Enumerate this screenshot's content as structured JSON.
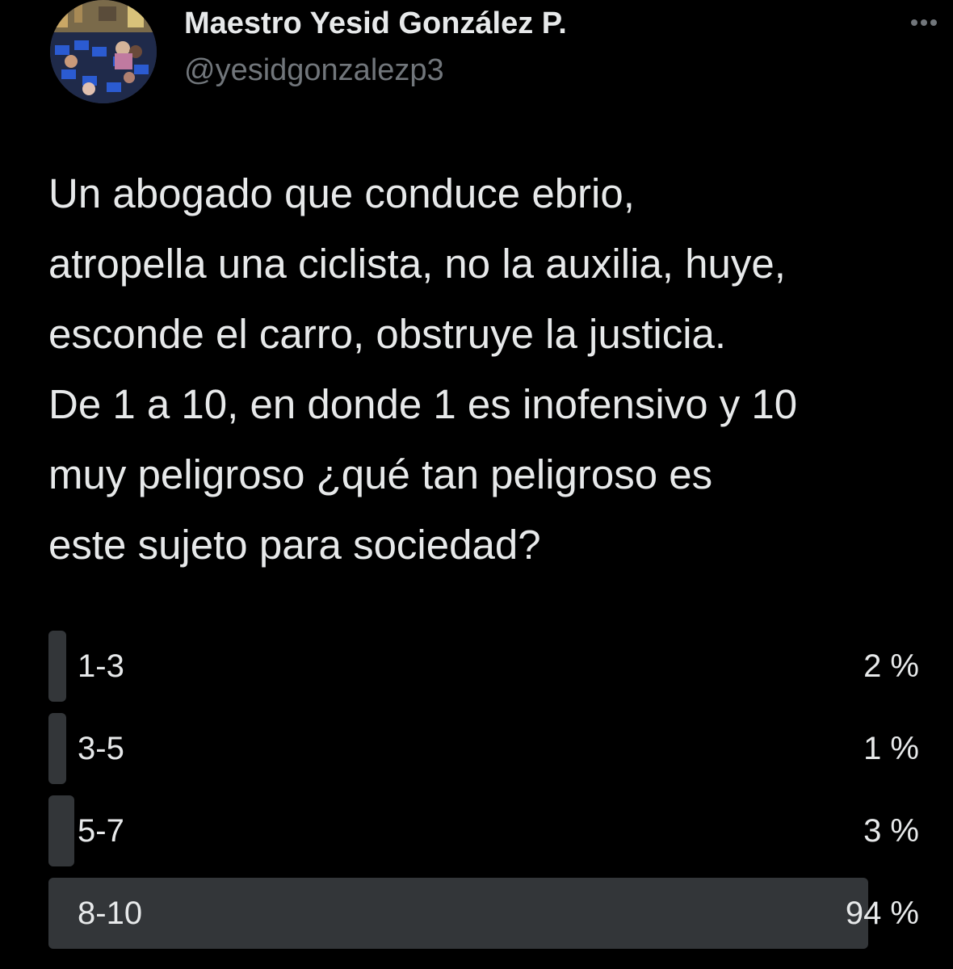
{
  "tweet": {
    "author": {
      "display_name": "Maestro Yesid González P.",
      "handle": "@yesidgonzalezp3"
    },
    "more_icon": "more-horizontal-icon",
    "text": "Un abogado que conduce ebrio,\natropella una ciclista, no la auxilia, huye,\nesconde el carro, obstruye la justicia.\nDe 1 a 10, en donde 1 es inofensivo y 10\nmuy peligroso ¿qué tan peligroso es\neste sujeto para sociedad?"
  },
  "poll": {
    "options": [
      {
        "label": "1-3",
        "percent_text": "2 %",
        "percent": 2
      },
      {
        "label": "3-5",
        "percent_text": "1 %",
        "percent": 1
      },
      {
        "label": "5-7",
        "percent_text": "3 %",
        "percent": 3
      },
      {
        "label": "8-10",
        "percent_text": "94 %",
        "percent": 94
      }
    ],
    "colors": {
      "bar": "#333639",
      "background": "#000000",
      "text": "#e7e9ea",
      "secondary_text": "#71767b"
    }
  }
}
